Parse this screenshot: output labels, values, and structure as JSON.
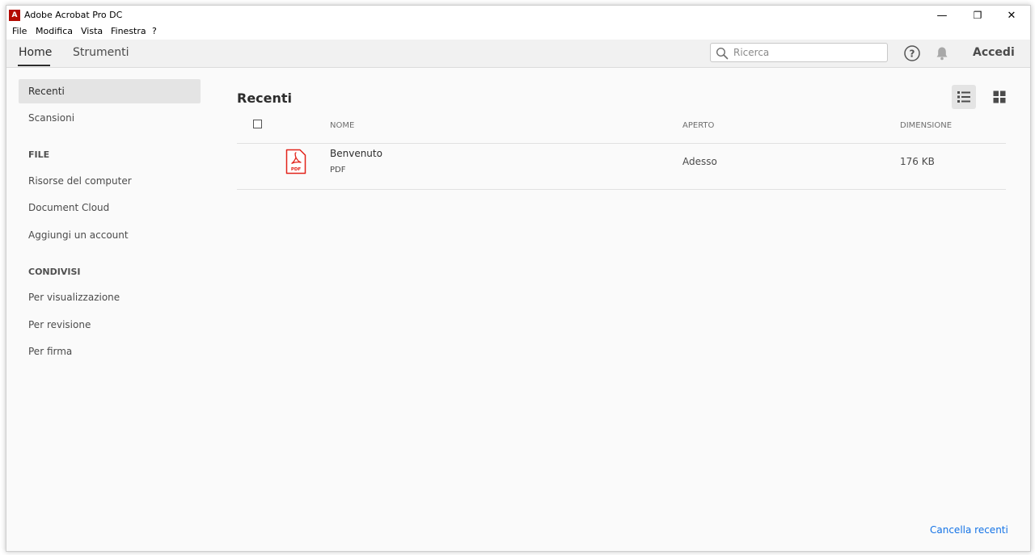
{
  "window": {
    "title": "Adobe Acrobat Pro DC",
    "logo_letter": "A",
    "controls": {
      "minimize": "—",
      "restore": "❐",
      "close": "✕"
    }
  },
  "menubar": {
    "items": [
      "File",
      "Modifica",
      "Vista",
      "Finestra",
      "?"
    ]
  },
  "toolbar": {
    "tabs": [
      {
        "label": "Home",
        "active": true
      },
      {
        "label": "Strumenti",
        "active": false
      }
    ],
    "search_placeholder": "Ricerca",
    "search_value": "",
    "help_icon": "help-circle-icon",
    "notifications_icon": "bell-icon",
    "signin_label": "Accedi"
  },
  "sidebar": {
    "items": [
      {
        "label": "Recenti",
        "selected": true
      },
      {
        "label": "Scansioni",
        "selected": false
      }
    ],
    "file_heading": "FILE",
    "file_items": [
      "Risorse del computer",
      "Document Cloud",
      "Aggiungi un account"
    ],
    "shared_heading": "CONDIVISI",
    "shared_items": [
      "Per visualizzazione",
      "Per revisione",
      "Per firma"
    ]
  },
  "main": {
    "title": "Recenti",
    "view_modes": [
      {
        "name": "list",
        "icon": "list-view-icon",
        "active": true
      },
      {
        "name": "grid",
        "icon": "grid-view-icon",
        "active": false
      }
    ],
    "columns": {
      "name": "NOME",
      "opened": "APERTO",
      "size": "DIMENSIONE"
    },
    "files": [
      {
        "name": "Benvenuto",
        "type": "PDF",
        "opened": "Adesso",
        "size": "176 KB",
        "icon_label": "PDF"
      }
    ],
    "clear_recent": "Cancella recenti"
  },
  "colors": {
    "accent_link": "#1473e6",
    "pdf_red": "#e2231a",
    "logo_red": "#b30b00"
  }
}
